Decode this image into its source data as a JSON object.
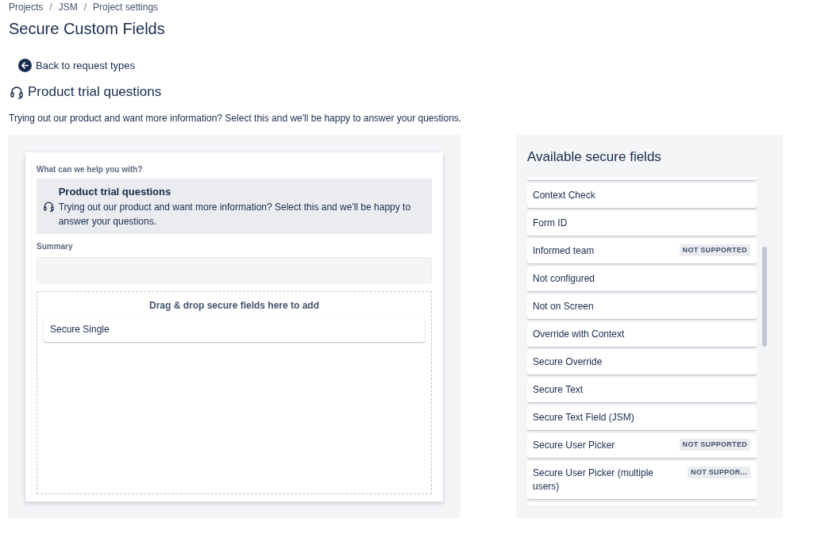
{
  "breadcrumbs": [
    "Projects",
    "JSM",
    "Project settings"
  ],
  "breadcrumb_separator": "/",
  "title": "Secure Custom Fields",
  "back_link": "Back to request types",
  "request_type": {
    "name": "Product trial questions",
    "description": "Trying out our product and want more information? Select this and we'll be happy to answer your questions."
  },
  "preview": {
    "question_label": "What can we help you with?",
    "option": {
      "name": "Product trial questions",
      "description": "Trying out our product and want more information? Select this and we'll be happy to answer your questions."
    },
    "summary_label": "Summary",
    "drop_zone": {
      "hint": "Drag & drop secure fields here to add",
      "fields": [
        "Secure Single"
      ]
    }
  },
  "available": {
    "title": "Available secure fields",
    "fields": [
      {
        "name": "Context Check"
      },
      {
        "name": "Form ID"
      },
      {
        "name": "Informed team",
        "badge": "NOT SUPPORTED"
      },
      {
        "name": "Not configured"
      },
      {
        "name": "Not on Screen"
      },
      {
        "name": "Override with Context"
      },
      {
        "name": "Secure Override"
      },
      {
        "name": "Secure Text"
      },
      {
        "name": "Secure Text Field (JSM)"
      },
      {
        "name": "Secure User Picker",
        "badge": "NOT SUPPORTED"
      },
      {
        "name": "Secure User Picker (multiple users)",
        "badge": "NOT SUPPOR..."
      }
    ]
  }
}
